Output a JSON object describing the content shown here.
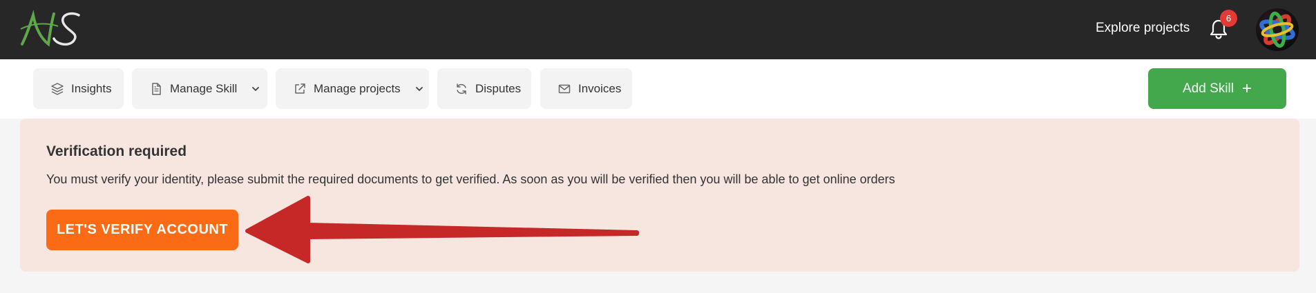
{
  "header": {
    "logo_text": "NS",
    "explore_label": "Explore projects",
    "notification_count": "6"
  },
  "toolbar": {
    "insights_label": "Insights",
    "manage_skill_label": "Manage Skill",
    "manage_projects_label": "Manage projects",
    "disputes_label": "Disputes",
    "invoices_label": "Invoices",
    "add_skill_label": "Add Skill",
    "add_skill_icon": "+"
  },
  "alert": {
    "title": "Verification required",
    "message": "You must verify your identity, please submit the required documents to get verified. As soon as you will be verified then you will be able to get online orders",
    "button_label": "LET'S VERIFY ACCOUNT"
  },
  "colors": {
    "topbar": "#272727",
    "add_skill": "#43a84b",
    "alert_bg": "#f7e6e0",
    "verify_button": "#fb6a14",
    "arrow": "#c62828",
    "badge": "#e53935"
  },
  "icons": {
    "insights": "layers-icon",
    "manage_skill": "document-icon",
    "manage_projects": "external-link-icon",
    "disputes": "refresh-icon",
    "invoices": "mail-icon",
    "dropdown": "chevron-down-icon",
    "notifications": "bell-icon",
    "annotation": "arrow-icon"
  }
}
